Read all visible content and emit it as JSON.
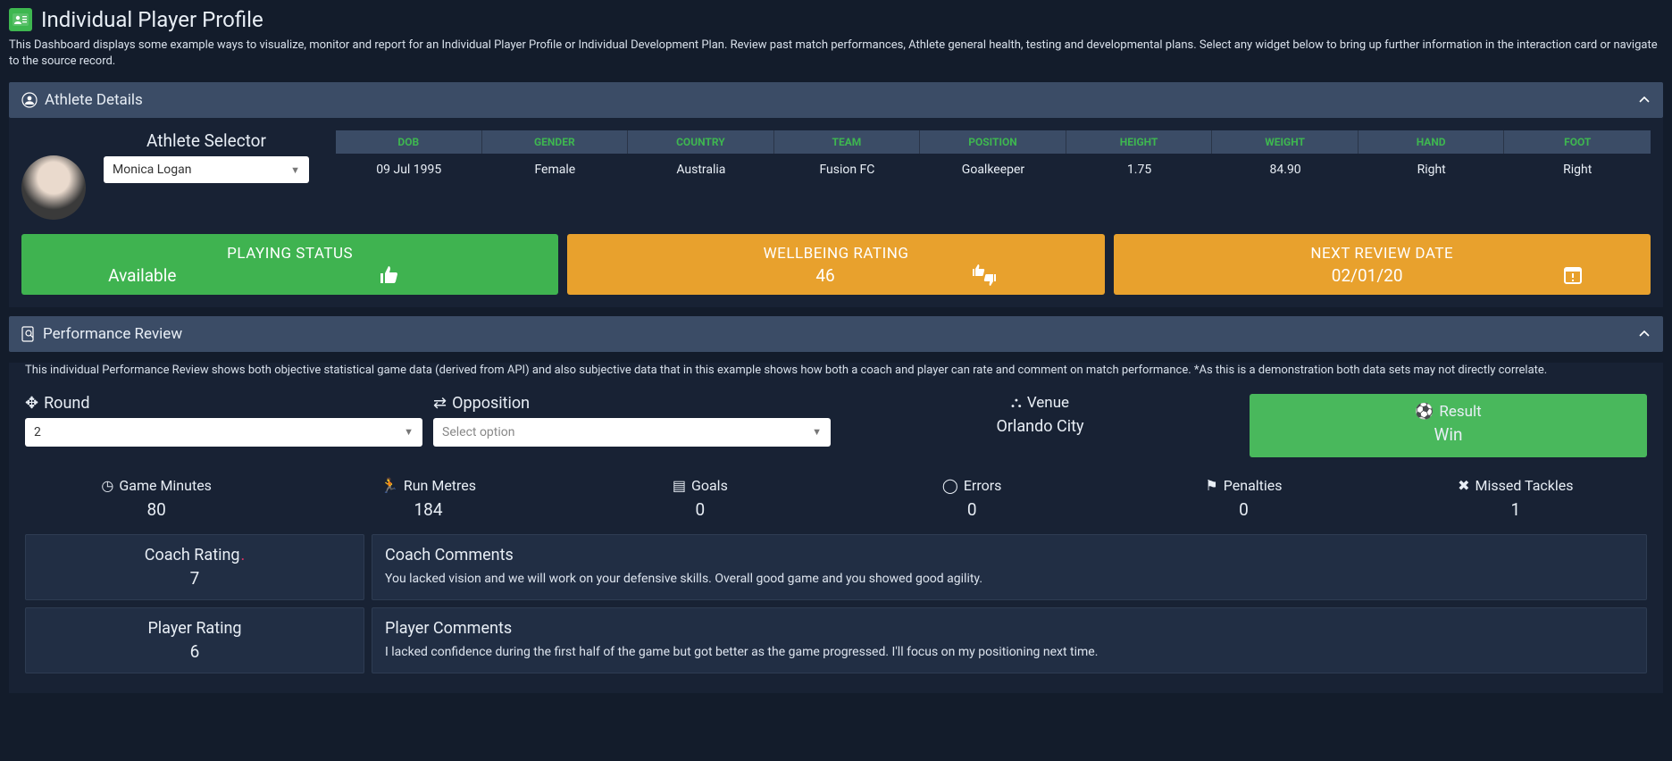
{
  "page": {
    "title": "Individual Player Profile",
    "description": "This Dashboard displays some example ways to visualize, monitor and report for an Individual Player Profile or Individual Development Plan. Review past match performances, Athlete general health, testing and developmental plans. Select any widget below to bring up further information in the interaction card or navigate to the source record."
  },
  "athlete_panel": {
    "title": "Athlete Details",
    "selector_label": "Athlete Selector",
    "selected_athlete": "Monica Logan",
    "columns": {
      "dob": "DOB",
      "gender": "GENDER",
      "country": "COUNTRY",
      "team": "TEAM",
      "position": "POSITION",
      "height": "HEIGHT",
      "weight": "WEIGHT",
      "hand": "HAND",
      "foot": "FOOT"
    },
    "values": {
      "dob": "09 Jul 1995",
      "gender": "Female",
      "country": "Australia",
      "team": "Fusion FC",
      "position": "Goalkeeper",
      "height": "1.75",
      "weight": "84.90",
      "hand": "Right",
      "foot": "Right"
    }
  },
  "status": {
    "playing": {
      "title": "PLAYING STATUS",
      "value": "Available"
    },
    "wellbeing": {
      "title": "WELLBEING RATING",
      "value": "46"
    },
    "review": {
      "title": "NEXT REVIEW DATE",
      "value": "02/01/20"
    }
  },
  "perf_panel": {
    "title": "Performance Review",
    "description": "This individual Performance Review shows both objective statistical game data (derived from API) and also subjective data that in this example shows how both a coach and player can rate and comment on match performance. *As this is a demonstration both data sets may not directly correlate."
  },
  "filters": {
    "round_label": "Round",
    "round_value": "2",
    "opposition_label": "Opposition",
    "opposition_placeholder": "Select option",
    "venue_label": "Venue",
    "venue_value": "Orlando City",
    "result_label": "Result",
    "result_value": "Win"
  },
  "stats": {
    "game_minutes": {
      "label": "Game Minutes",
      "value": "80"
    },
    "run_metres": {
      "label": "Run Metres",
      "value": "184"
    },
    "goals": {
      "label": "Goals",
      "value": "0"
    },
    "errors": {
      "label": "Errors",
      "value": "0"
    },
    "penalties": {
      "label": "Penalties",
      "value": "0"
    },
    "missed_tackles": {
      "label": "Missed Tackles",
      "value": "1"
    }
  },
  "ratings": {
    "coach_rating_label": "Coach Rating",
    "coach_rating_value": "7",
    "coach_comments_label": "Coach Comments",
    "coach_comments_value": "You lacked vision and we will work on your defensive skills. Overall good game and you showed good agility.",
    "player_rating_label": "Player Rating",
    "player_rating_value": "6",
    "player_comments_label": "Player Comments",
    "player_comments_value": "I lacked confidence during the first half of the game but got better as the game progressed. I'll focus on my positioning next time."
  }
}
